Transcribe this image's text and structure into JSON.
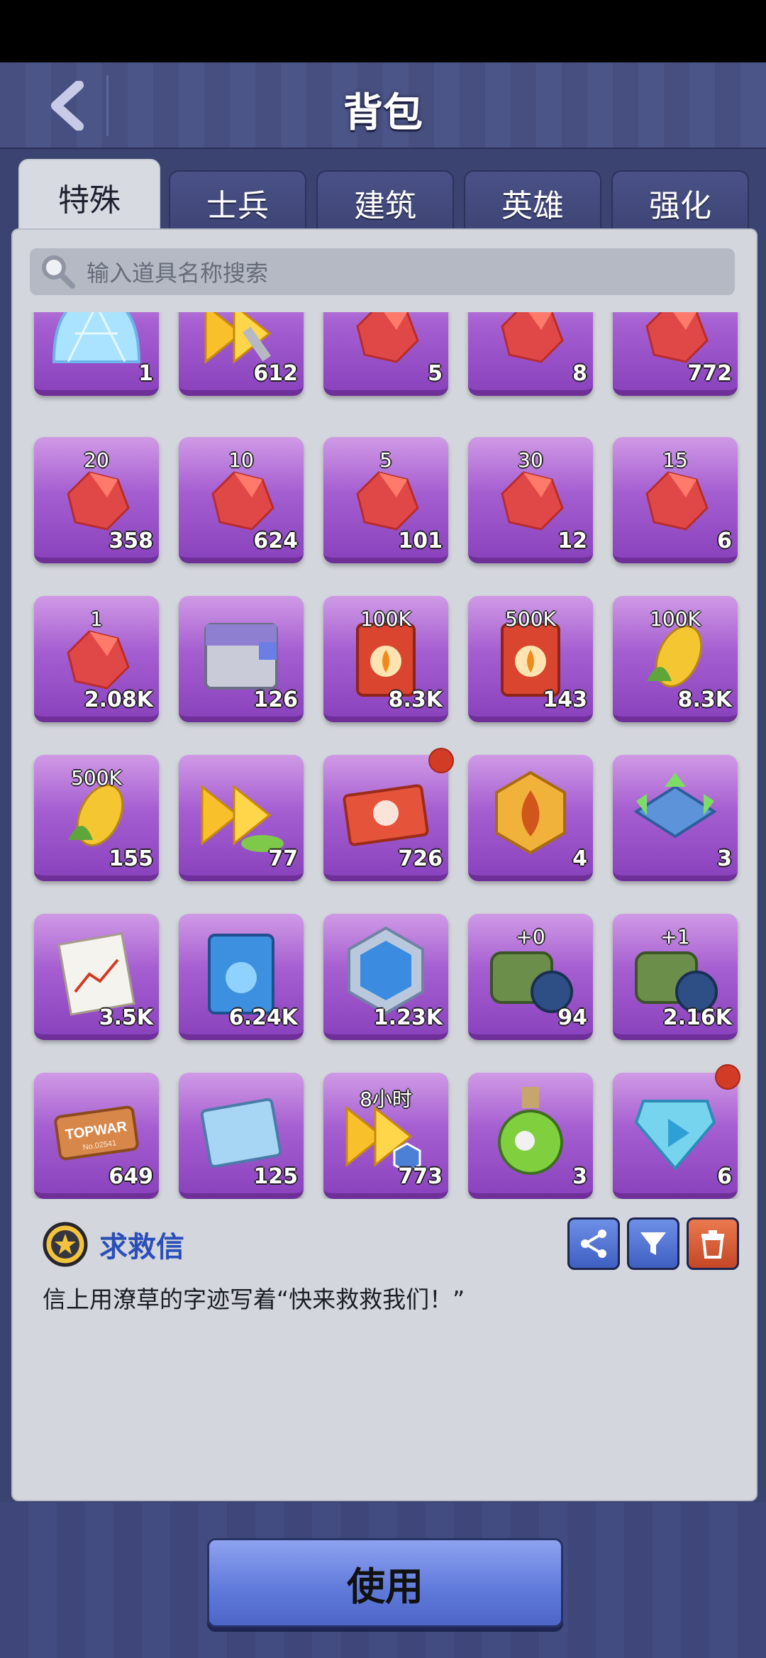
{
  "header": {
    "title": "背包"
  },
  "tabs": [
    {
      "label": "特殊",
      "active": true
    },
    {
      "label": "士兵",
      "active": false
    },
    {
      "label": "建筑",
      "active": false
    },
    {
      "label": "英雄",
      "active": false
    },
    {
      "label": "强化",
      "active": false
    }
  ],
  "search": {
    "placeholder": "输入道具名称搜索"
  },
  "items": [
    {
      "icon": "shield-dome-icon",
      "badge": "",
      "count": "1"
    },
    {
      "icon": "speedup-wrench-icon",
      "badge": "",
      "count": "612"
    },
    {
      "icon": "ruby-icon",
      "badge": "",
      "count": "5"
    },
    {
      "icon": "ruby-icon",
      "badge": "",
      "count": "8"
    },
    {
      "icon": "ruby-icon",
      "badge": "",
      "count": "772"
    },
    {
      "icon": "ruby-icon",
      "badge": "20",
      "count": "358"
    },
    {
      "icon": "ruby-icon",
      "badge": "10",
      "count": "624"
    },
    {
      "icon": "ruby-icon",
      "badge": "5",
      "count": "101"
    },
    {
      "icon": "ruby-icon",
      "badge": "30",
      "count": "12"
    },
    {
      "icon": "ruby-icon",
      "badge": "15",
      "count": "6"
    },
    {
      "icon": "ruby-icon",
      "badge": "1",
      "count": "2.08K"
    },
    {
      "icon": "supply-crate-icon",
      "badge": "",
      "count": "126"
    },
    {
      "icon": "fuel-can-icon",
      "badge": "100K",
      "count": "8.3K"
    },
    {
      "icon": "fuel-can-icon",
      "badge": "500K",
      "count": "143"
    },
    {
      "icon": "corn-icon",
      "badge": "100K",
      "count": "8.3K"
    },
    {
      "icon": "corn-icon",
      "badge": "500K",
      "count": "155"
    },
    {
      "icon": "speedup-boot-icon",
      "badge": "",
      "count": "77"
    },
    {
      "icon": "ticket-icon",
      "badge": "",
      "count": "726",
      "reddot": true
    },
    {
      "icon": "fire-medal-icon",
      "badge": "",
      "count": "4"
    },
    {
      "icon": "relocate-icon",
      "badge": "",
      "count": "3"
    },
    {
      "icon": "chart-document-icon",
      "badge": "",
      "count": "3.5K"
    },
    {
      "icon": "blue-card-icon",
      "badge": "",
      "count": "6.24K"
    },
    {
      "icon": "hex-emblem-icon",
      "badge": "",
      "count": "1.23K"
    },
    {
      "icon": "backpack-bomb-icon",
      "badge": "+0",
      "count": "94"
    },
    {
      "icon": "backpack-bomb-icon",
      "badge": "+1",
      "count": "2.16K"
    },
    {
      "icon": "topwar-badge-icon",
      "badge": "",
      "count": "649"
    },
    {
      "icon": "blueprint-icon",
      "badge": "",
      "count": "125"
    },
    {
      "icon": "speedup-hex-icon",
      "badge": "8小时",
      "count": "773"
    },
    {
      "icon": "poison-flask-icon",
      "badge": "",
      "count": "3"
    },
    {
      "icon": "blue-gem-icon",
      "badge": "",
      "count": "6",
      "reddot": true
    }
  ],
  "itemIconText": {
    "topwar": "TOPWAR",
    "topwar_sub": "No.02541"
  },
  "selected": {
    "name": "求救信",
    "description": "信上用潦草的字迹写着“快来救救我们！”"
  },
  "actions": {
    "use_label": "使用"
  },
  "colors": {
    "accent": "#2b4fb8",
    "tile": "#a65fd1",
    "redDot": "#d23b25"
  }
}
